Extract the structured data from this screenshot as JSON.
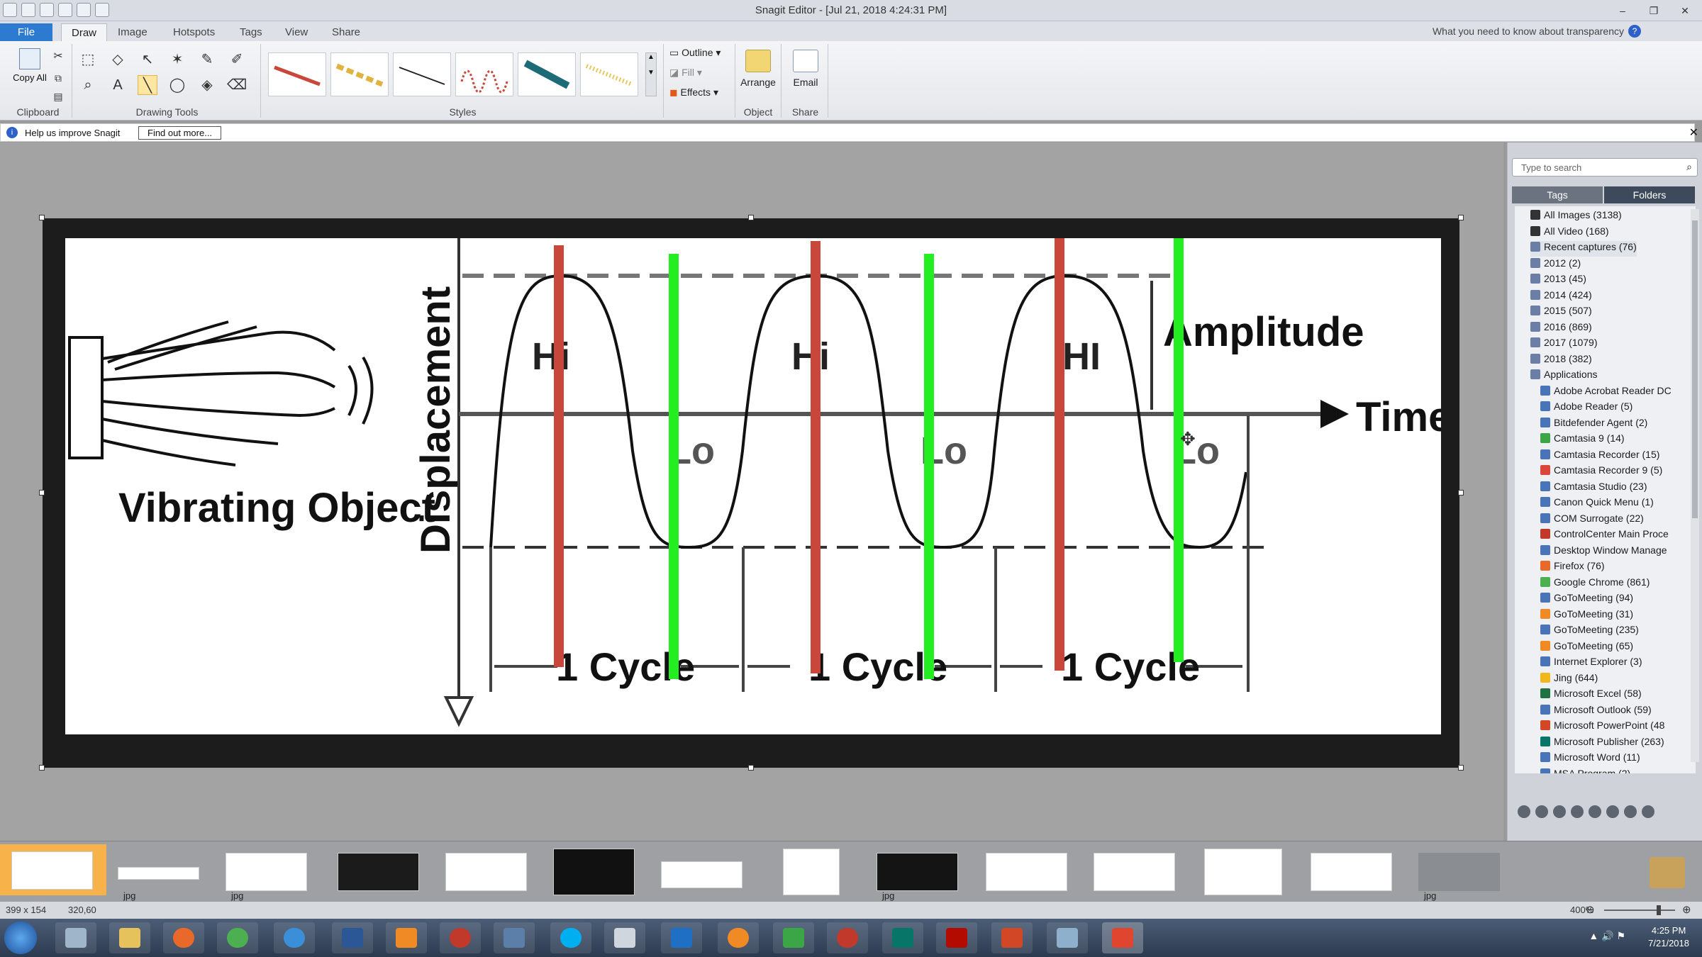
{
  "window": {
    "title": "Snagit Editor - [Jul 21, 2018 4:24:31 PM]",
    "hint_link": "What you need to know about transparency"
  },
  "ribbon_tabs": [
    "File",
    "Draw",
    "Image",
    "Hotspots",
    "Tags",
    "View",
    "Share"
  ],
  "ribbon": {
    "clipboard": {
      "copy_all": "Copy All",
      "label": "Clipboard"
    },
    "drawing_tools_label": "Drawing Tools",
    "styles_label": "Styles",
    "outline": "Outline",
    "fill": "Fill",
    "effects": "Effects",
    "arrange": "Arrange",
    "object_label": "Object",
    "email": "Email",
    "share_label": "Share"
  },
  "infobar": {
    "text": "Help us improve Snagit",
    "button": "Find out more..."
  },
  "image": {
    "left_caption": "Vibrating Object",
    "y_axis": "Displacement",
    "x_axis": "Time",
    "amplitude": "Amplitude",
    "hi_labels": [
      "Hi",
      "Hi",
      "HI"
    ],
    "lo_labels": [
      "Lo",
      "Lo",
      "Lo"
    ],
    "cycle_labels": [
      "1 Cycle",
      "1 Cycle",
      "1 Cycle"
    ]
  },
  "library": {
    "search_placeholder": "Type to search",
    "tabs": [
      "Tags",
      "Folders"
    ],
    "items": [
      {
        "label": "All Images (3138)",
        "color": "#333"
      },
      {
        "label": "All Video (168)",
        "color": "#333"
      },
      {
        "label": "Recent captures (76)",
        "color": "#6b7fa6"
      },
      {
        "label": "2012 (2)",
        "color": "#6b7fa6"
      },
      {
        "label": "2013 (45)",
        "color": "#6b7fa6"
      },
      {
        "label": "2014 (424)",
        "color": "#6b7fa6"
      },
      {
        "label": "2015 (507)",
        "color": "#6b7fa6"
      },
      {
        "label": "2016 (869)",
        "color": "#6b7fa6"
      },
      {
        "label": "2017 (1079)",
        "color": "#6b7fa6"
      },
      {
        "label": "2018 (382)",
        "color": "#6b7fa6"
      },
      {
        "label": "Applications",
        "color": "#6b7fa6"
      },
      {
        "label": "Adobe Acrobat Reader DC",
        "color": "#4a74b8"
      },
      {
        "label": "Adobe Reader  (5)",
        "color": "#4a74b8"
      },
      {
        "label": "Bitdefender Agent (2)",
        "color": "#4a74b8"
      },
      {
        "label": "Camtasia 9 (14)",
        "color": "#3aa645"
      },
      {
        "label": "Camtasia Recorder (15)",
        "color": "#4a74b8"
      },
      {
        "label": "Camtasia Recorder 9 (5)",
        "color": "#d9463a"
      },
      {
        "label": "Camtasia Studio (23)",
        "color": "#4a74b8"
      },
      {
        "label": "Canon Quick Menu (1)",
        "color": "#4a74b8"
      },
      {
        "label": "COM Surrogate (22)",
        "color": "#4a74b8"
      },
      {
        "label": "ControlCenter Main Proce",
        "color": "#c0392b"
      },
      {
        "label": "Desktop Window Manage",
        "color": "#4a74b8"
      },
      {
        "label": "Firefox (76)",
        "color": "#e8692a"
      },
      {
        "label": "Google Chrome (861)",
        "color": "#4caf50"
      },
      {
        "label": "GoToMeeting (94)",
        "color": "#4a74b8"
      },
      {
        "label": "GoToMeeting (31)",
        "color": "#f08a24"
      },
      {
        "label": "GoToMeeting (235)",
        "color": "#4a74b8"
      },
      {
        "label": "GoToMeeting (65)",
        "color": "#f08a24"
      },
      {
        "label": "Internet Explorer (3)",
        "color": "#4a74b8"
      },
      {
        "label": "Jing (644)",
        "color": "#f2b81b"
      },
      {
        "label": "Microsoft Excel (58)",
        "color": "#207245"
      },
      {
        "label": "Microsoft Outlook (59)",
        "color": "#4a74b8"
      },
      {
        "label": "Microsoft PowerPoint (48",
        "color": "#d24726"
      },
      {
        "label": "Microsoft Publisher (263)",
        "color": "#077568"
      },
      {
        "label": "Microsoft Word (11)",
        "color": "#4a74b8"
      },
      {
        "label": "MSA Program (2)",
        "color": "#4a74b8"
      }
    ]
  },
  "tray": {
    "labels": [
      "jpg",
      "jpg",
      "jpg",
      "jpg"
    ]
  },
  "status": {
    "dimensions": "399 x 154",
    "position": "320,60",
    "zoom": "400%"
  },
  "clock": {
    "time": "4:25 PM",
    "date": "7/21/2018"
  },
  "colors": {
    "accent": "#2d7bd1",
    "hi_marker": "#c9473a",
    "lo_marker": "#22ee22"
  }
}
